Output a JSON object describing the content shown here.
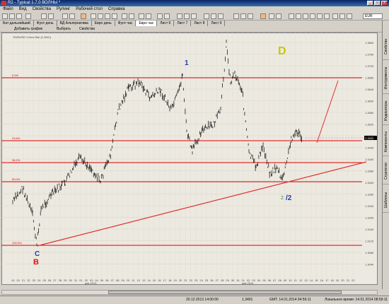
{
  "window": {
    "title": "R2 - Typical 1.7.0 ВОЛНЫ *",
    "min": "_",
    "max": "□",
    "close": "x"
  },
  "menu": [
    "Файл",
    "Вид",
    "Свойства",
    "Рулинг",
    "Рабочий стол",
    "Справка"
  ],
  "toolbar": {
    "symbol": "EUR"
  },
  "tabs": [
    {
      "label": "Бат дальнейший"
    },
    {
      "label": "Фунт день"
    },
    {
      "label": "ВД Альтернатива"
    },
    {
      "label": "Евро день"
    },
    {
      "label": "Фунт час"
    },
    {
      "label": "Евро час"
    },
    {
      "label": "Лист 6"
    },
    {
      "label": "Лист 7"
    },
    {
      "label": "Лист 8"
    },
    {
      "label": "Лист 9"
    }
  ],
  "chart_toolbar": {
    "add_chart": "Добавить график",
    "select": "Выбрать",
    "properties": "Свойства"
  },
  "chart": {
    "title": "EURUSD 1 Hour Bar (1.3401)",
    "price_label": "1.3402",
    "price_axis": [
      "1.3800",
      "1.3760",
      "1.3720",
      "1.3680",
      "1.3640",
      "1.3600",
      "1.3560",
      "1.3520",
      "1.3480",
      "1.3440",
      "1.3400",
      "1.3360",
      "1.3320",
      "1.3280",
      "1.3240",
      "1.3200",
      "1.3160",
      "1.3120",
      "1.3080",
      "1.3040"
    ],
    "fib_levels": [
      {
        "label": "0.0%"
      },
      {
        "label": "23.6%"
      },
      {
        "label": "38.2%"
      },
      {
        "label": "50.0%"
      },
      {
        "label": "61.8%"
      },
      {
        "label": "100.0%"
      }
    ],
    "wave_labels": {
      "d": "D",
      "c": "C",
      "b": "B",
      "one": "1",
      "two": "/2",
      "two_prefix": "2"
    },
    "x_axis_days": [
      "19",
      "20",
      "21",
      "22",
      "23",
      "24",
      "25",
      "26",
      "27",
      "28",
      "29",
      "30",
      "31",
      "01",
      "02",
      "03",
      "04",
      "05",
      "06",
      "07",
      "08",
      "09",
      "10",
      "11",
      "12",
      "13",
      "14",
      "15",
      "16",
      "17",
      "18",
      "19",
      "20",
      "21",
      "22",
      "23",
      "24",
      "25",
      "26",
      "27",
      "28",
      "29",
      "30",
      "31",
      "01",
      "02",
      "03",
      "04",
      "05",
      "06",
      "07",
      "08",
      "09",
      "10",
      "11",
      "12",
      "13",
      "14",
      "15",
      "16",
      "17",
      "18",
      "19",
      "20",
      "21",
      "22"
    ],
    "x_axis_months": [
      "дек 2013",
      "янв 2014"
    ],
    "colors": {
      "fib": "#dd0000",
      "trend": "#e03030",
      "wave_blue": "#1e3caa",
      "wave_red": "#e01010",
      "wave_yellow": "#c8c800"
    }
  },
  "sidebar": [
    "Свойства",
    "Инструменты",
    "Индикаторы",
    "Компоненты",
    "Стратегии",
    "Шаблоны"
  ],
  "status": {
    "time1": "20.12.2013 14:00:00",
    "price": "1.3401",
    "gmt": "GMT: 14.01.2014 04:59:11",
    "local": "Локальное время: 14.01.2014 08:59:11"
  }
}
